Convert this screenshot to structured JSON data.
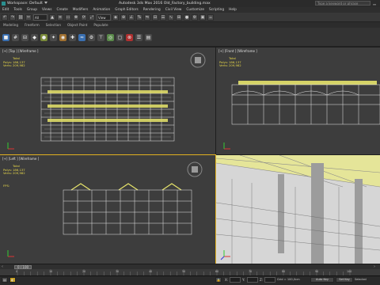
{
  "titlebar": {
    "workspace_label": "Workspace: Default",
    "title": "Autodesk 3ds Max 2016    Old_Factory_building.max",
    "search_placeholder": "Type a keyword or phrase"
  },
  "menu": [
    "Edit",
    "Tools",
    "Group",
    "Views",
    "Create",
    "Modifiers",
    "Animation",
    "Graph Editors",
    "Rendering",
    "Civil View",
    "Customize",
    "Scripting",
    "Help"
  ],
  "toolbar": {
    "selection_filter": "All",
    "view_select": "View"
  },
  "ribbon": [
    "Modeling",
    "Freeform",
    "Selection",
    "Object Paint",
    "Populate"
  ],
  "viewports": {
    "top": {
      "label": "[+] [Top ] [Wireframe ]"
    },
    "front": {
      "label": "[+] [Front ] [Wireframe ]"
    },
    "left": {
      "label": "[+] [Left ] [Wireframe ]"
    },
    "persp": {
      "label": ""
    }
  },
  "stats": {
    "total": "Total",
    "polys_label": "Polys:",
    "polys_value": "186,137",
    "verts_label": "Verts:",
    "verts_value": "209,982",
    "fps_label": "FPS:"
  },
  "timeline": {
    "frame": "0 / 100",
    "ticks": [
      "0",
      "10",
      "20",
      "30",
      "40",
      "50",
      "60",
      "70",
      "80",
      "90",
      "100"
    ]
  },
  "status": {
    "x_label": "X:",
    "y_label": "Y:",
    "z_label": "Z:",
    "grid": "Grid = 100,0cm",
    "autokey": "Auto Key",
    "setkey": "Set Key",
    "selected": "Selected"
  },
  "colors": {
    "accent": "#e0b020",
    "stats": "#e8d84a",
    "wire_fill": "#e6e36a",
    "persp_bg": "#d6d6d6"
  }
}
